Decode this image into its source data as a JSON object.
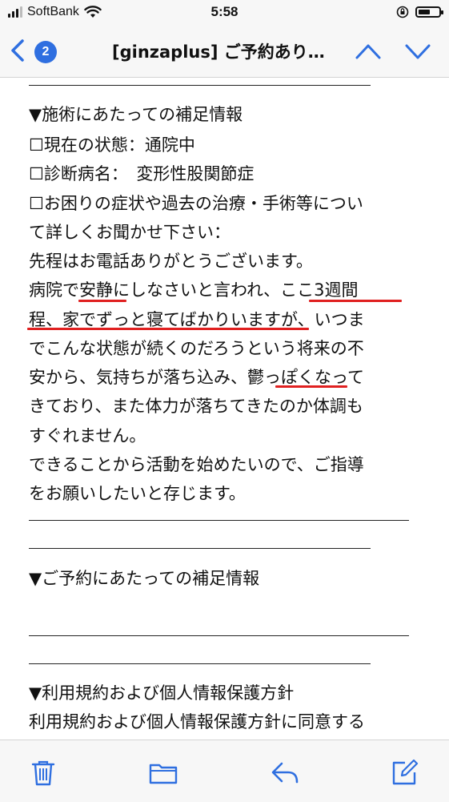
{
  "status_bar": {
    "carrier": "SoftBank",
    "time": "5:58",
    "battery_level": 0.6
  },
  "nav": {
    "back_icon": "chevron-left-icon",
    "badge_count": "2",
    "title": "[ginzaplus] ご予約あり…",
    "accent_color": "#2f6fe0"
  },
  "email": {
    "section1_heading": "▼施術にあたっての補足情報",
    "current_state": "☐現在の状態：通院中",
    "diagnosis": "☐診断病名：　変形性股関節症",
    "symptoms_q1": "☐お困りの症状や過去の治療・手術等につい",
    "symptoms_q2": "て詳しくお聞かせ下さい：",
    "body_lines": [
      "先程はお電話ありがとうございます。",
      "病院で安静にしなさいと言われ、ここ3週間",
      "程、家でずっと寝てばかりいますが、いつま",
      "でこんな状態が続くのだろうという将来の不",
      "安から、気持ちが落ち込み、鬱っぽくなって",
      "きており、また体力が落ちてきたのか体調も",
      "すぐれません。",
      "できることから活動を始めたいので、ご指導",
      "をお願いしたいと存じます。"
    ],
    "section2_heading": "▼ご予約にあたっての補足情報",
    "section3_heading": "▼利用規約および個人情報保護方針",
    "consent": "利用規約および個人情報保護方針に同意する",
    "underline_color": "#e02020"
  },
  "toolbar": {
    "icons": [
      "trash-icon",
      "folder-icon",
      "reply-icon",
      "compose-icon"
    ]
  }
}
